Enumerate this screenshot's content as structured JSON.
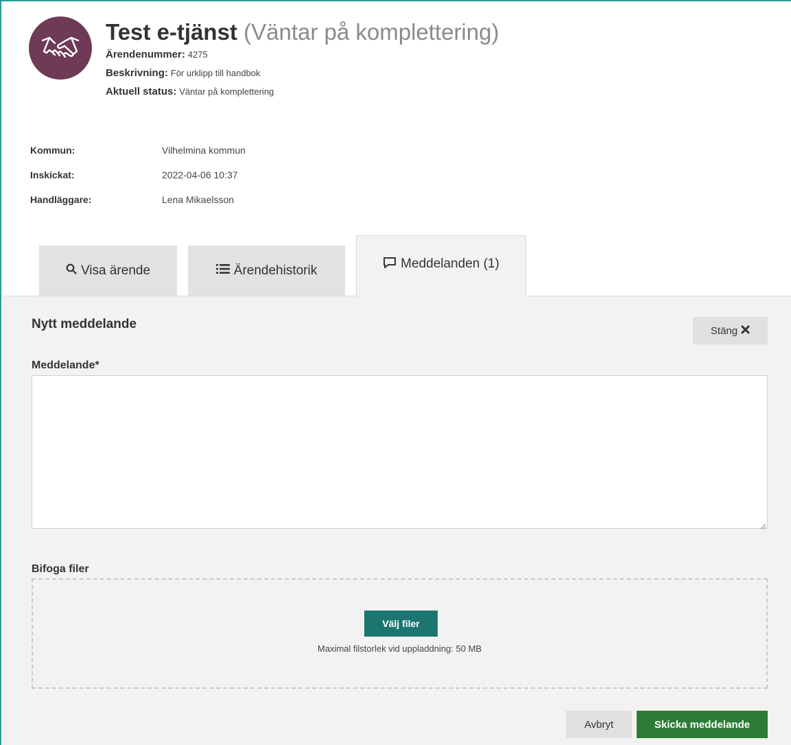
{
  "header": {
    "title": "Test e-tjänst",
    "status_in_title": "(Väntar på komplettering)",
    "meta": [
      {
        "label": "Ärendenummer:",
        "value": "4275"
      },
      {
        "label": "Beskrivning:",
        "value": "För urklipp till handbok"
      },
      {
        "label": "Aktuell status:",
        "value": "Väntar på komplettering"
      }
    ],
    "logo_icon": "handshake-icon"
  },
  "info": [
    {
      "label": "Kommun:",
      "value": "Vilhelmina kommun"
    },
    {
      "label": "Inskickat:",
      "value": "2022-04-06 10:37"
    },
    {
      "label": "Handläggare:",
      "value": "Lena Mikaelsson"
    }
  ],
  "tabs": [
    {
      "label": "Visa ärende",
      "icon": "search-icon"
    },
    {
      "label": "Ärendehistorik",
      "icon": "list-icon"
    },
    {
      "label": "Meddelanden (1)",
      "icon": "speech-bubble-icon",
      "active": true
    }
  ],
  "message_form": {
    "title": "Nytt meddelande",
    "close_label": "Stäng",
    "message_label": "Meddelande*",
    "message_value": "",
    "attach_label": "Bifoga filer",
    "choose_files_label": "Välj filer",
    "max_size_text": "Maximal filstorlek vid uppladdning: 50 MB",
    "cancel_label": "Avbryt",
    "send_label": "Skicka meddelande"
  },
  "colors": {
    "accent_border": "#2a9d9a",
    "logo_bg": "#6e3a55",
    "choose_btn": "#1d7571",
    "send_btn": "#2c7c35"
  }
}
